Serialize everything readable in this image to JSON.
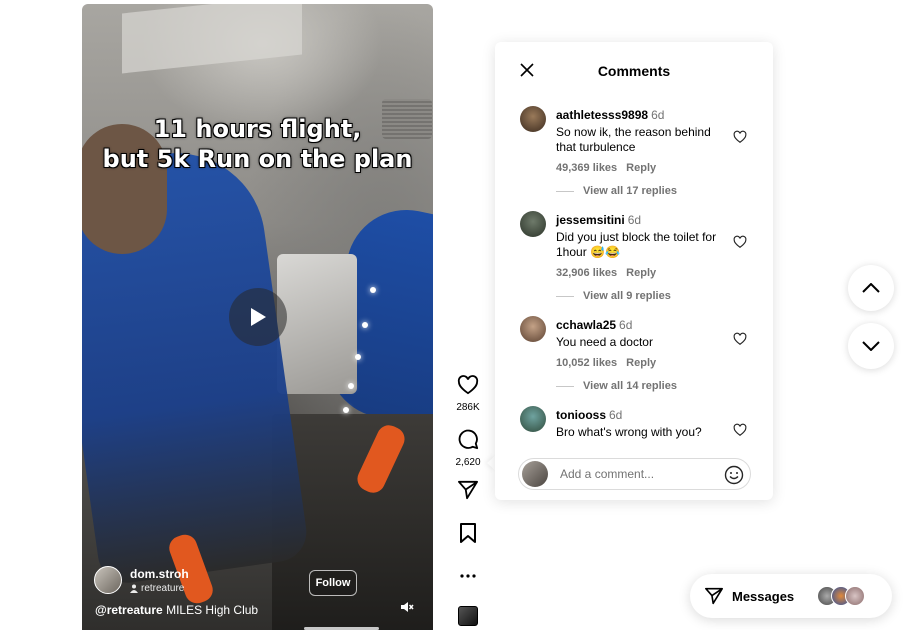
{
  "video": {
    "caption_line1": "11 hours flight,",
    "caption_line2": "but 5k Run on the plan",
    "author": "dom.stroh",
    "audio_label": "retreature",
    "follow_label": "Follow",
    "description_mention": "@retreature",
    "description_text": " MILES High Club"
  },
  "actions": {
    "likes": "286K",
    "comments": "2,620"
  },
  "comments_panel": {
    "title": "Comments",
    "items": [
      {
        "user": "aathletesss9898",
        "time": "6d",
        "text": "So now ik, the reason behind that turbulence",
        "likes": "49,369 likes",
        "reply_label": "Reply",
        "view_replies": "View all 17 replies"
      },
      {
        "user": "jessemsitini",
        "time": "6d",
        "text": "Did you just block the toilet for 1hour 😅😂",
        "likes": "32,906 likes",
        "reply_label": "Reply",
        "view_replies": "View all 9 replies"
      },
      {
        "user": "cchawla25",
        "time": "6d",
        "text": "You need a doctor",
        "likes": "10,052 likes",
        "reply_label": "Reply",
        "view_replies": "View all 14 replies"
      },
      {
        "user": "toniooss",
        "time": "6d",
        "text": "Bro what's wrong with you?"
      }
    ],
    "add_comment_placeholder": "Add a comment..."
  },
  "messages": {
    "label": "Messages"
  },
  "colors": {
    "accent_blue": "#1e4ea6",
    "muted_text": "#737373",
    "border": "#dbdbdb"
  }
}
